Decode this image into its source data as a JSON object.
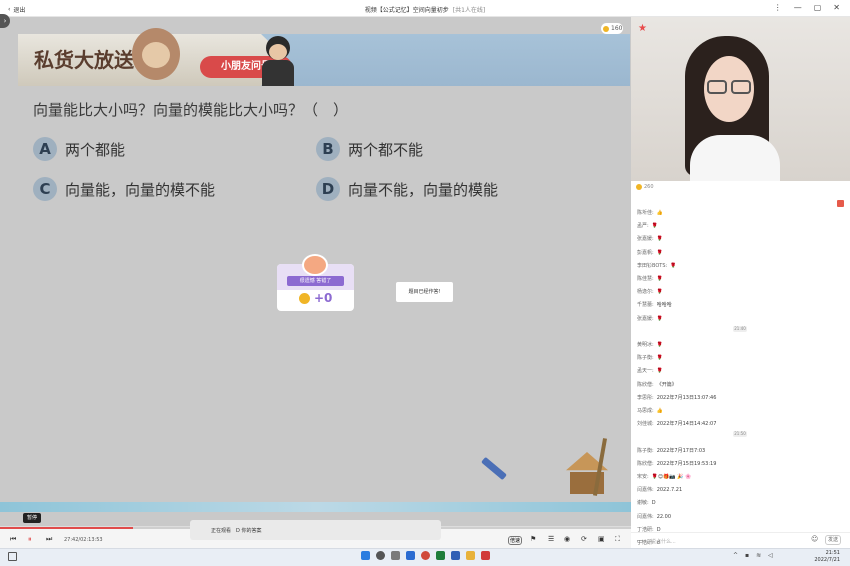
{
  "window": {
    "back_label": "退出",
    "title": "视频【公式记忆】空间向量初步",
    "subtitle": "[共1人在线]",
    "controls": [
      "⋮",
      "—",
      "▢",
      "✕"
    ]
  },
  "slide": {
    "banner_title": "私货大放送",
    "kid_tag": "小朋友问号",
    "question": "向量能比大小吗？向量的模能比大小吗？（　）",
    "options": [
      {
        "letter": "A",
        "text": "两个都能"
      },
      {
        "letter": "B",
        "text": "两个都不能"
      },
      {
        "letter": "C",
        "text": "向量能，向量的模不能"
      },
      {
        "letter": "D",
        "text": "向量不能，向量的模能"
      }
    ],
    "coin_badge": "160"
  },
  "reward": {
    "banner": "很遗憾 答错了",
    "value": "+0"
  },
  "toast": "题目已经作答!",
  "player": {
    "pause_tip": "暂停",
    "time": "27:42/02:13:53",
    "subtitle_left": "正在观看",
    "subtitle_right": "D  你的答案",
    "speed": "倍速",
    "progress": 0.21
  },
  "chat": {
    "coin": "260",
    "messages": [
      {
        "name": "陈圻佳:",
        "text": "👍"
      },
      {
        "name": "孟严:",
        "text": "🌹"
      },
      {
        "name": "张嘉媛:",
        "text": "🌹"
      },
      {
        "name": "彭嘉帆:",
        "text": "🌹"
      },
      {
        "name": "李田钐BOTS:",
        "text": "🌹"
      },
      {
        "name": "陈佳慧:",
        "text": "🌹"
      },
      {
        "name": "杨逸尔:",
        "text": "🌹"
      },
      {
        "name": "千慧蕾:",
        "text": "哈哈哈"
      },
      {
        "name": "张嘉媛:",
        "text": "🌹"
      }
    ],
    "time1": "21:40",
    "messages2": [
      {
        "name": "黄明冰:",
        "text": "🌹"
      },
      {
        "name": "陈子衡:",
        "text": "🌹"
      },
      {
        "name": "孟天一:",
        "text": "🌹"
      },
      {
        "name": "陈欣僧:",
        "text": "《开篇》"
      },
      {
        "name": "李思彤:",
        "text": "2022年7月13日13:07:46"
      },
      {
        "name": "马思成:",
        "text": "👍"
      },
      {
        "name": "刘佳城:",
        "text": "2022年7月14日14:42:07"
      }
    ],
    "time2": "21:50",
    "messages3": [
      {
        "name": "陈子衡:",
        "text": "2022年7月17日7:03"
      },
      {
        "name": "陈欣僧:",
        "text": "2022年7月15日19:53:19"
      },
      {
        "name": "宋安:",
        "text": "🌹😊🎁📷 🎉 🌸"
      },
      {
        "name": "闫嘉伟:",
        "text": "2022.7.21"
      },
      {
        "name": "谢敏:",
        "text": "D"
      },
      {
        "name": "闫嘉伟:",
        "text": "22.00"
      },
      {
        "name": "丁浩研:",
        "text": "D"
      },
      {
        "name": "丁浩研:",
        "text": "d"
      },
      {
        "name": "宋安:",
        "text": "🌹 📱 🎁"
      }
    ],
    "input_placeholder": "说点什么...",
    "send": "发送"
  },
  "taskbar": {
    "time": "21:51",
    "date": "2022/7/21"
  }
}
